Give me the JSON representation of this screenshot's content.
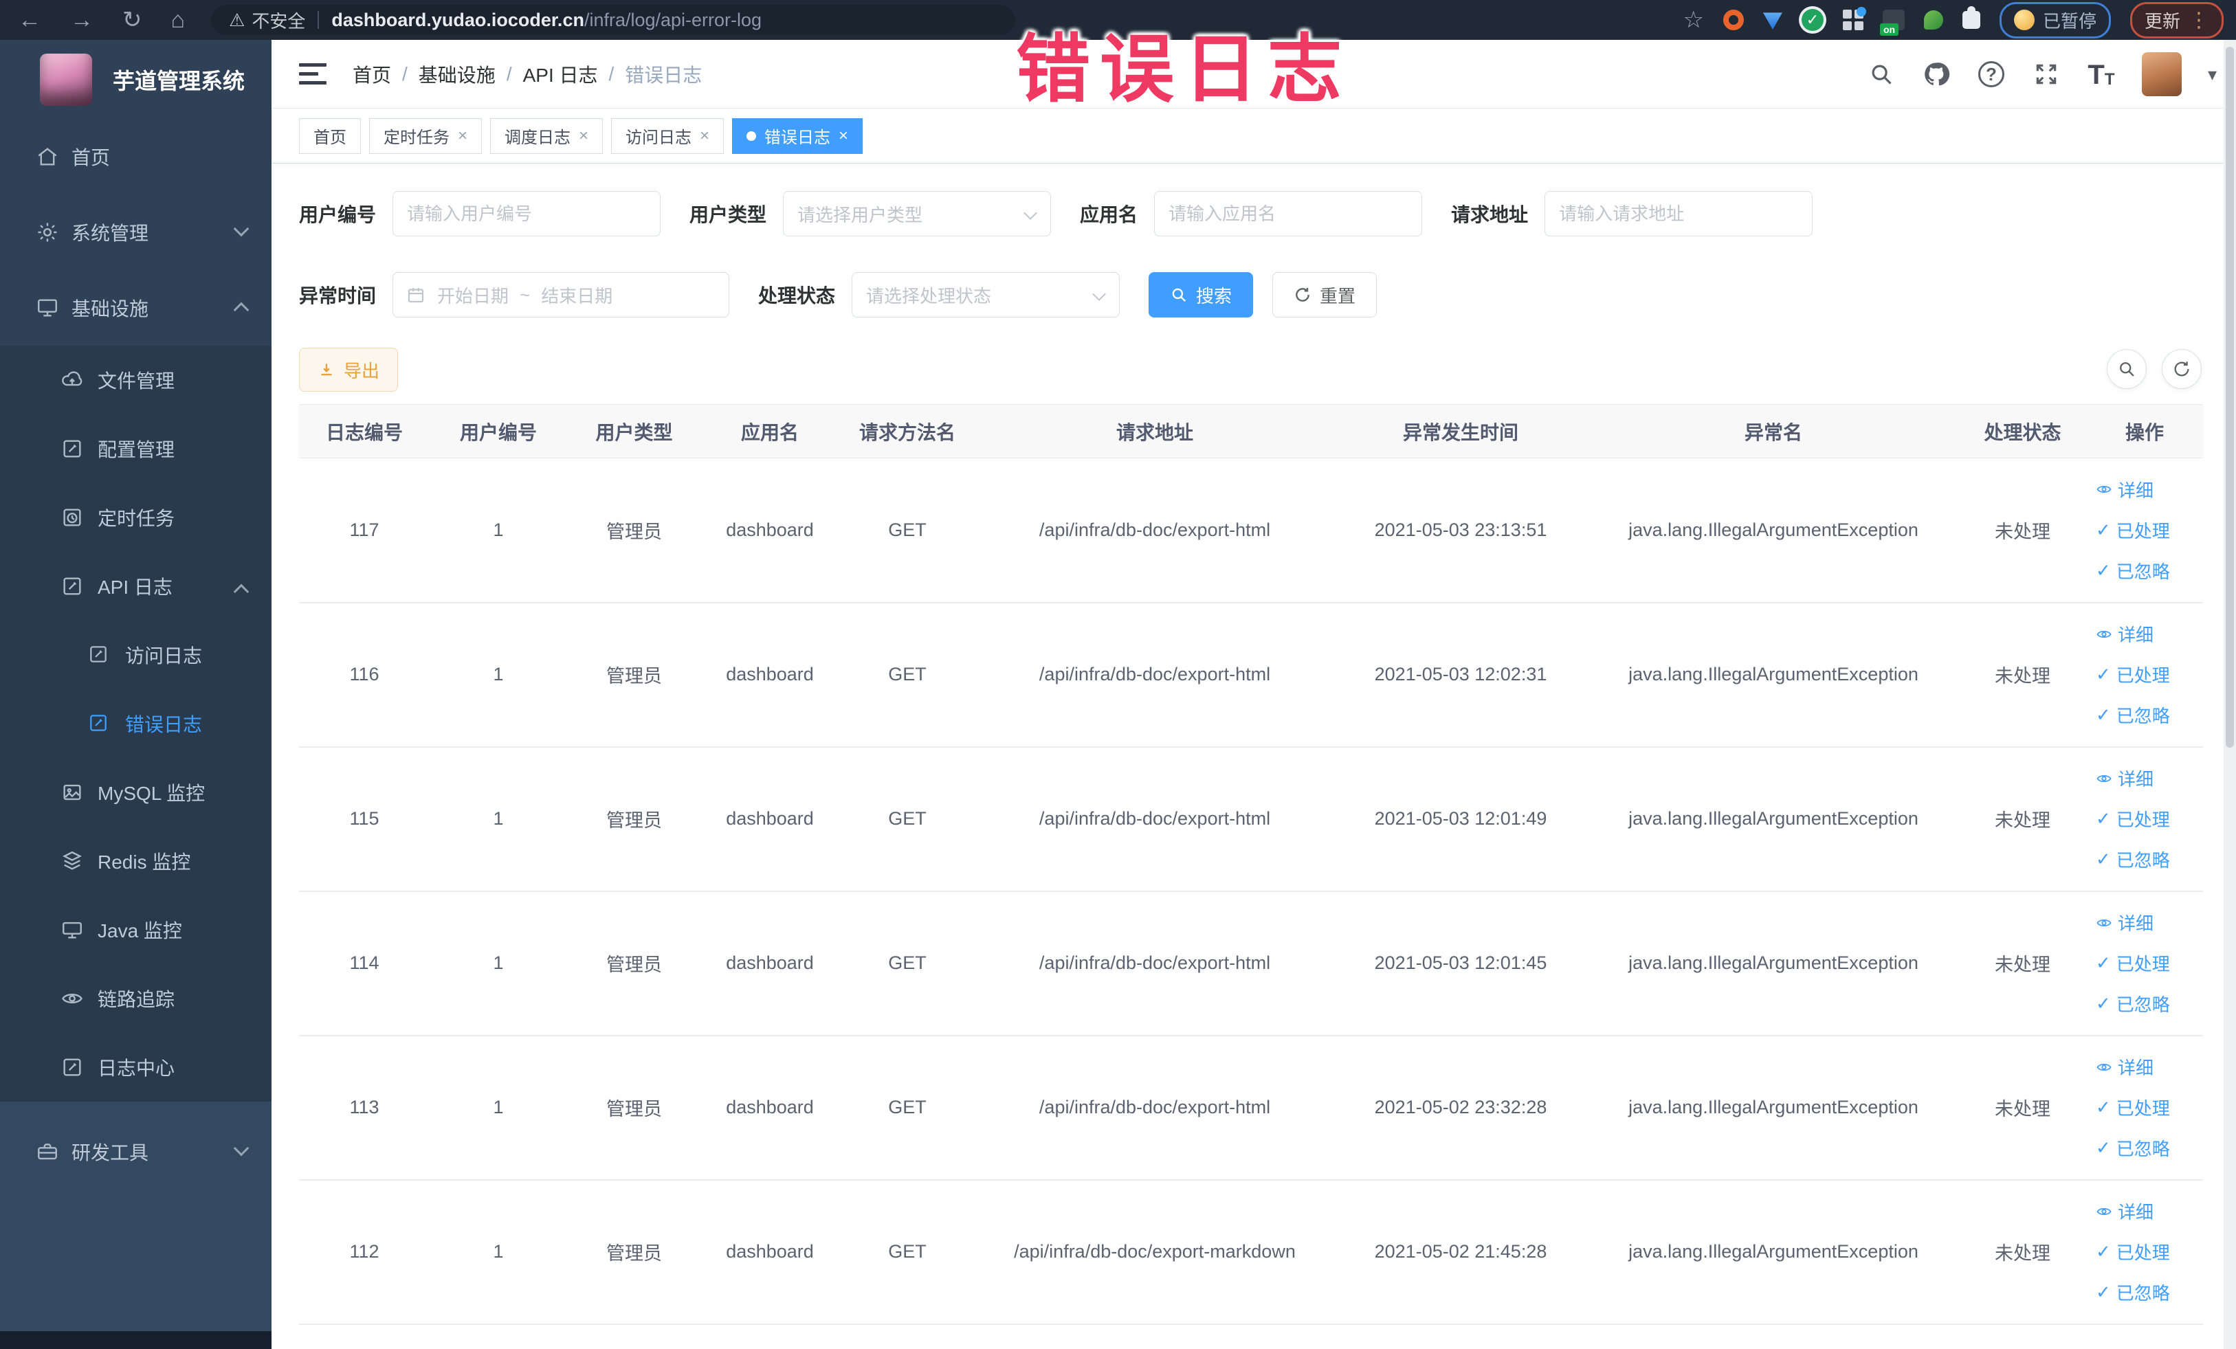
{
  "browser": {
    "security_label": "不安全",
    "url_domain": "dashboard.yudao.iocoder.cn",
    "url_path": "/infra/log/api-error-log",
    "paused_badge": "已暂停",
    "update_badge": "更新"
  },
  "icons": {
    "back": "←",
    "forward": "→",
    "reload": "↻",
    "home": "⌂",
    "warning": "⚠",
    "star": "☆",
    "kebab": "⋮",
    "caret_down": "▾",
    "close": "×",
    "check": "✓",
    "question": "?",
    "letter_T_big": "T",
    "letter_T_small": "T",
    "on_badge": "on"
  },
  "overlay": {
    "text": "错误日志",
    "color": "#ee3a62"
  },
  "sidebar": {
    "title": "芋道管理系统",
    "items": [
      {
        "label": "首页"
      },
      {
        "label": "系统管理"
      },
      {
        "label": "基础设施"
      },
      {
        "label": "文件管理"
      },
      {
        "label": "配置管理"
      },
      {
        "label": "定时任务"
      },
      {
        "label": "API 日志"
      },
      {
        "label": "访问日志"
      },
      {
        "label": "错误日志"
      },
      {
        "label": "MySQL 监控"
      },
      {
        "label": "Redis 监控"
      },
      {
        "label": "Java 监控"
      },
      {
        "label": "链路追踪"
      },
      {
        "label": "日志中心"
      },
      {
        "label": "研发工具"
      }
    ]
  },
  "breadcrumb": {
    "separator": "/",
    "items": [
      "首页",
      "基础设施",
      "API 日志",
      "错误日志"
    ]
  },
  "tabs": [
    {
      "label": "首页"
    },
    {
      "label": "定时任务"
    },
    {
      "label": "调度日志"
    },
    {
      "label": "访问日志"
    },
    {
      "label": "错误日志"
    }
  ],
  "filters": {
    "user_id_label": "用户编号",
    "user_id_placeholder": "请输入用户编号",
    "user_type_label": "用户类型",
    "user_type_placeholder": "请选择用户类型",
    "app_name_label": "应用名",
    "app_name_placeholder": "请输入应用名",
    "request_url_label": "请求地址",
    "request_url_placeholder": "请输入请求地址",
    "exception_time_label": "异常时间",
    "date_start_placeholder": "开始日期",
    "date_separator": "~",
    "date_end_placeholder": "结束日期",
    "process_status_label": "处理状态",
    "process_status_placeholder": "请选择处理状态",
    "search_label": "搜索",
    "reset_label": "重置"
  },
  "toolbar": {
    "export_label": "导出"
  },
  "table": {
    "columns": [
      "日志编号",
      "用户编号",
      "用户类型",
      "应用名",
      "请求方法名",
      "请求地址",
      "异常发生时间",
      "异常名",
      "处理状态",
      "操作"
    ],
    "actions": {
      "detail": "详细",
      "processed": "已处理",
      "ignored": "已忽略"
    },
    "rows": [
      {
        "id": "117",
        "user_id": "1",
        "user_type": "管理员",
        "app": "dashboard",
        "method": "GET",
        "url": "/api/infra/db-doc/export-html",
        "time": "2021-05-03 23:13:51",
        "exception": "java.lang.IllegalArgumentException",
        "status": "未处理"
      },
      {
        "id": "116",
        "user_id": "1",
        "user_type": "管理员",
        "app": "dashboard",
        "method": "GET",
        "url": "/api/infra/db-doc/export-html",
        "time": "2021-05-03 12:02:31",
        "exception": "java.lang.IllegalArgumentException",
        "status": "未处理"
      },
      {
        "id": "115",
        "user_id": "1",
        "user_type": "管理员",
        "app": "dashboard",
        "method": "GET",
        "url": "/api/infra/db-doc/export-html",
        "time": "2021-05-03 12:01:49",
        "exception": "java.lang.IllegalArgumentException",
        "status": "未处理"
      },
      {
        "id": "114",
        "user_id": "1",
        "user_type": "管理员",
        "app": "dashboard",
        "method": "GET",
        "url": "/api/infra/db-doc/export-html",
        "time": "2021-05-03 12:01:45",
        "exception": "java.lang.IllegalArgumentException",
        "status": "未处理"
      },
      {
        "id": "113",
        "user_id": "1",
        "user_type": "管理员",
        "app": "dashboard",
        "method": "GET",
        "url": "/api/infra/db-doc/export-html",
        "time": "2021-05-02 23:32:28",
        "exception": "java.lang.IllegalArgumentException",
        "status": "未处理"
      },
      {
        "id": "112",
        "user_id": "1",
        "user_type": "管理员",
        "app": "dashboard",
        "method": "GET",
        "url": "/api/infra/db-doc/export-markdown",
        "time": "2021-05-02 21:45:28",
        "exception": "java.lang.IllegalArgumentException",
        "status": "未处理"
      }
    ]
  },
  "colors": {
    "accent": "#409EFF",
    "overlay": "#ee3a62",
    "warning": "#e6a23c"
  }
}
